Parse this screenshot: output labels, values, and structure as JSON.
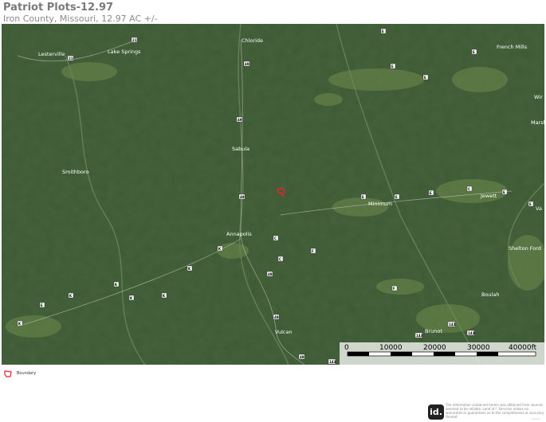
{
  "header": {
    "title": "Patriot Plots-12.97",
    "subtitle": "Iron County, Missouri, 12.97 AC +/-"
  },
  "map": {
    "places": [
      "Lesterville",
      "Lake Springs",
      "Chloride",
      "French Mills",
      "Sabula",
      "Smithboro",
      "Minimum",
      "Jewett",
      "Annapolis",
      "Shelton Ford",
      "Boulah",
      "Brunot",
      "Vulcan",
      "Wir",
      "Marsh Creek",
      "Va"
    ],
    "road_labels": [
      "21",
      "21",
      "E",
      "E",
      "E",
      "E",
      "49",
      "49",
      "49",
      "49",
      "E",
      "E",
      "C",
      "E",
      "E",
      "C",
      "K",
      "C",
      "F",
      "E",
      "K",
      "K",
      "K",
      "K",
      "K",
      "49",
      "F",
      "49",
      "143",
      "143",
      "143",
      "49",
      "143",
      "143",
      "143",
      "143",
      "E",
      "E",
      "K"
    ],
    "scale_bar": {
      "labels": [
        "0",
        "10000",
        "20000",
        "30000",
        "40000ft"
      ]
    },
    "colors": {
      "terrain": "#3b5a33",
      "boundary": "#e8242a"
    }
  },
  "legend": {
    "label": "Boundary",
    "color": "#e8242a"
  },
  "footer": {
    "logo": "id.",
    "disclaimer": "The information contained herein was obtained from sources deemed to be reliable. Land id™ Services makes no warranties or guarantees as to the completeness or accuracy thereof.",
    "version": "land id"
  }
}
